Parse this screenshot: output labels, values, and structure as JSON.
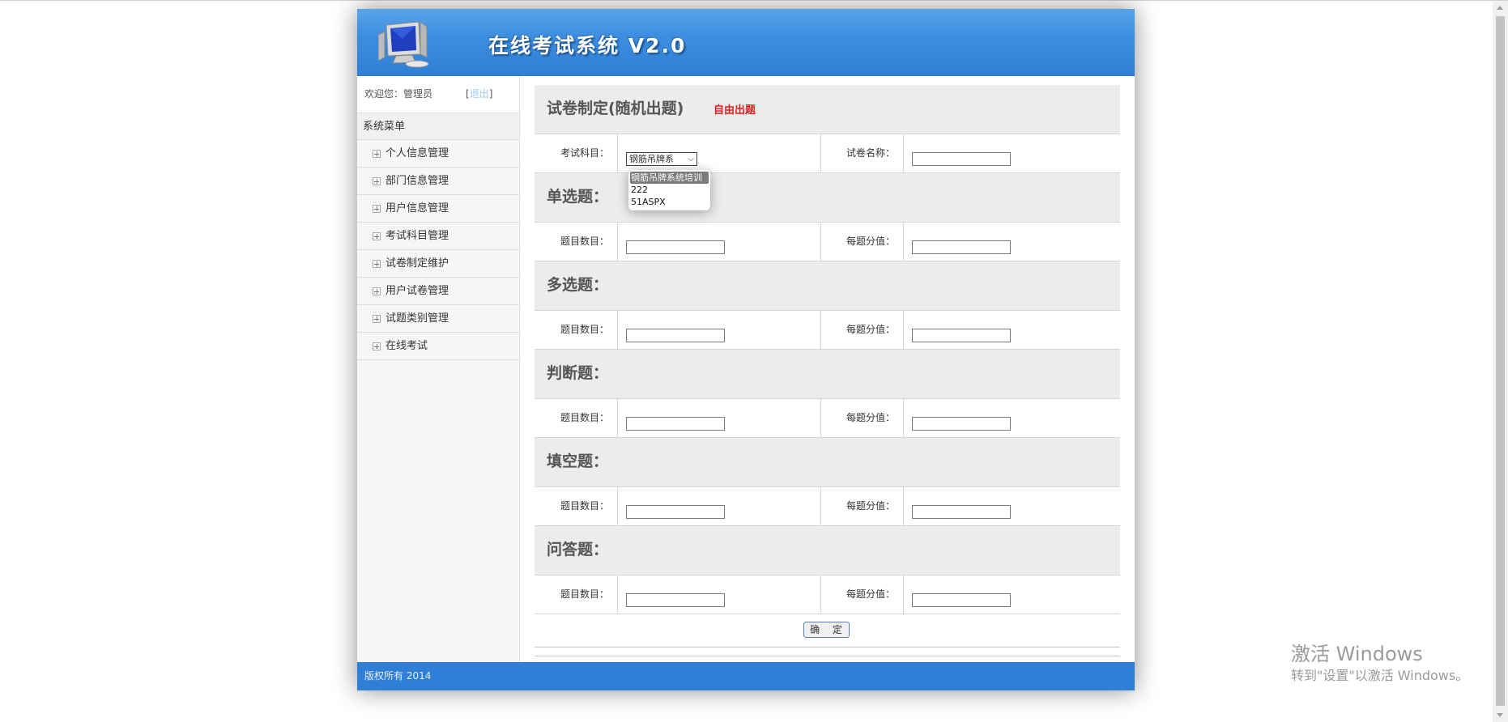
{
  "header": {
    "title": "在线考试系统 V2.0",
    "logo_icon": "computer-monitor-icon"
  },
  "sidebar": {
    "welcome": "欢迎您：管理员",
    "logout_open": "[",
    "logout_label": "退出",
    "logout_close": "]",
    "menu_title": "系统菜单",
    "items": [
      {
        "label": "个人信息管理"
      },
      {
        "label": "部门信息管理"
      },
      {
        "label": "用户信息管理"
      },
      {
        "label": "考试科目管理"
      },
      {
        "label": "试卷制定维护"
      },
      {
        "label": "用户试卷管理"
      },
      {
        "label": "试题类别管理"
      },
      {
        "label": "在线考试"
      }
    ]
  },
  "main": {
    "title": "试卷制定(随机出题)",
    "free_link": "自由出题",
    "subject_label": "考试科目：",
    "subject_selected": "钢筋吊牌系",
    "paper_name_label": "试卷名称：",
    "paper_name_value": "",
    "sections": [
      {
        "title": "单选题：",
        "count_label": "题目数目：",
        "score_label": "每题分值："
      },
      {
        "title": "多选题：",
        "count_label": "题目数目：",
        "score_label": "每题分值："
      },
      {
        "title": "判断题：",
        "count_label": "题目数目：",
        "score_label": "每题分值："
      },
      {
        "title": "填空题：",
        "count_label": "题目数目：",
        "score_label": "每题分值："
      },
      {
        "title": "问答题：",
        "count_label": "题目数目：",
        "score_label": "每题分值："
      }
    ],
    "submit_label": "确 定"
  },
  "dropdown": {
    "options": [
      "钢筋吊牌系统培训",
      "222",
      "51ASPX"
    ],
    "selected_index": 0
  },
  "footer": {
    "text": "版权所有 2014"
  },
  "watermark": {
    "line1": "激活 Windows",
    "line2": "转到\"设置\"以激活 Windows。"
  }
}
